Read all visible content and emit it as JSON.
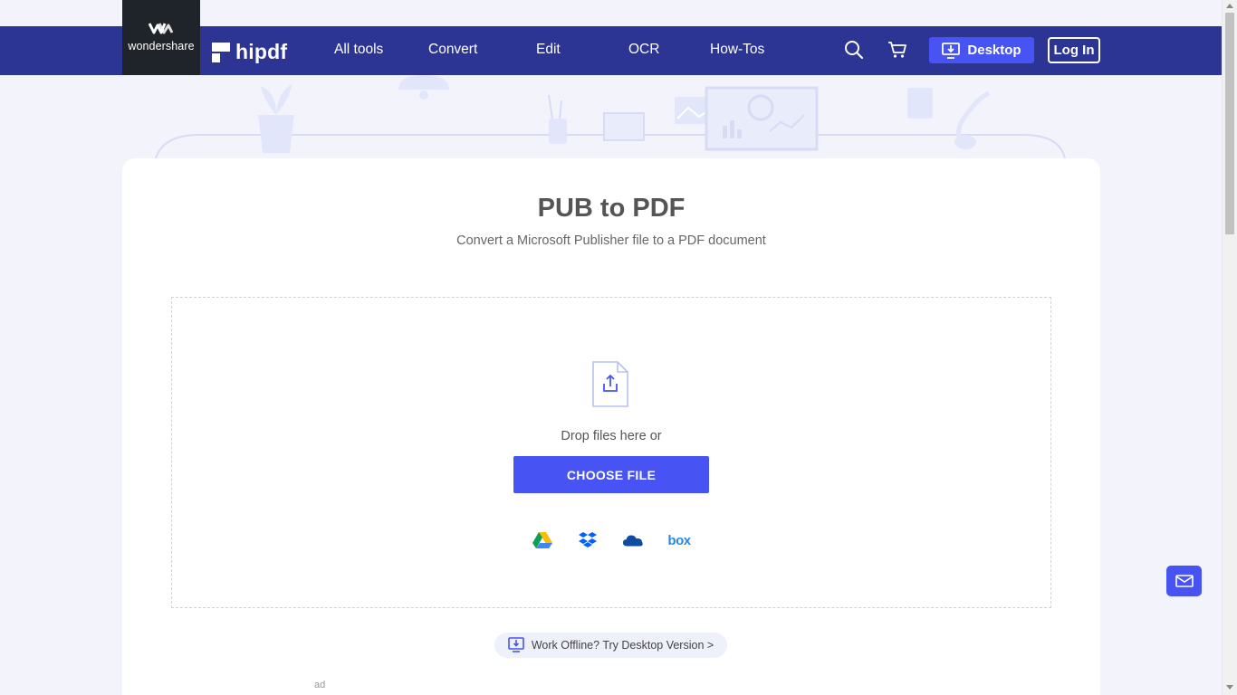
{
  "brand": {
    "wondershare": "wondershare",
    "hipdf": "hipdf"
  },
  "nav": {
    "items": [
      {
        "label": "All tools"
      },
      {
        "label": "Convert"
      },
      {
        "label": "Edit"
      },
      {
        "label": "OCR"
      },
      {
        "label": "How-Tos"
      }
    ],
    "desktop_label": "Desktop",
    "login_label": "Log In",
    "icons": [
      "search-icon",
      "cart-icon",
      "download-desktop-icon"
    ]
  },
  "main": {
    "title": "PUB to PDF",
    "subtitle": "Convert a Microsoft Publisher file to a PDF document",
    "drop_text": "Drop files here or",
    "choose_label": "CHOOSE FILE",
    "cloud_sources": [
      "google-drive-icon",
      "dropbox-icon",
      "onedrive-icon",
      "box-icon"
    ],
    "box_label": "box",
    "offline_text": "Work Offline? Try Desktop Version >",
    "ad_label": "ad"
  },
  "colors": {
    "nav_bg": "#2c3494",
    "accent": "#4753f3",
    "brand_bg": "#1f242b",
    "page_bg": "#f3f4fb"
  }
}
